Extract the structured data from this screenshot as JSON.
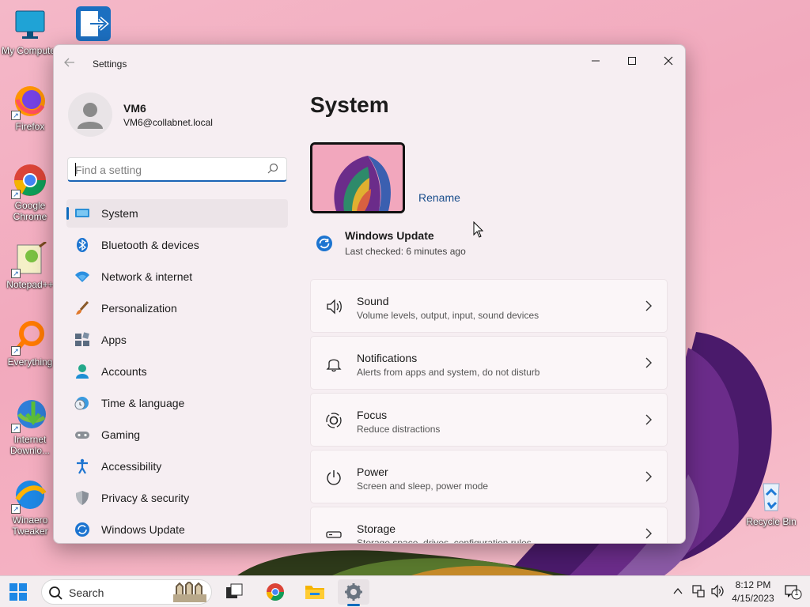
{
  "desktop": {
    "icons": [
      {
        "label": "My Computer",
        "icon": "monitor-icon"
      },
      {
        "label": "",
        "icon": "shortcut-arrow-app-icon"
      },
      {
        "label": "Firefox",
        "icon": "firefox-icon"
      },
      {
        "label": "Google Chrome",
        "icon": "chrome-icon"
      },
      {
        "label": "Notepad++",
        "icon": "notepadpp-icon"
      },
      {
        "label": "Everything",
        "icon": "everything-search-icon"
      },
      {
        "label": "Internet Downlo...",
        "icon": "idm-icon"
      },
      {
        "label": "Winaero Tweaker",
        "icon": "winaero-icon"
      },
      {
        "label": "Recycle Bin",
        "icon": "recycle-bin-icon"
      }
    ]
  },
  "window": {
    "app_title": "Settings",
    "controls": {
      "minimize": "—",
      "maximize": "☐",
      "close": "✕"
    }
  },
  "profile": {
    "name": "VM6",
    "email": "VM6@collabnet.local"
  },
  "search": {
    "placeholder": "Find a setting"
  },
  "nav": {
    "items": [
      {
        "label": "System",
        "icon": "system-display-icon",
        "active": true
      },
      {
        "label": "Bluetooth & devices",
        "icon": "bluetooth-icon"
      },
      {
        "label": "Network & internet",
        "icon": "wifi-icon"
      },
      {
        "label": "Personalization",
        "icon": "paintbrush-icon"
      },
      {
        "label": "Apps",
        "icon": "apps-icon"
      },
      {
        "label": "Accounts",
        "icon": "accounts-icon"
      },
      {
        "label": "Time & language",
        "icon": "globe-clock-icon"
      },
      {
        "label": "Gaming",
        "icon": "gamepad-icon"
      },
      {
        "label": "Accessibility",
        "icon": "accessibility-icon"
      },
      {
        "label": "Privacy & security",
        "icon": "shield-icon"
      },
      {
        "label": "Windows Update",
        "icon": "windows-update-icon"
      }
    ]
  },
  "main": {
    "title": "System",
    "rename": "Rename",
    "windows_update": {
      "title": "Windows Update",
      "subtitle": "Last checked: 6 minutes ago"
    },
    "cards": [
      {
        "title": "Sound",
        "subtitle": "Volume levels, output, input, sound devices",
        "icon": "speaker-icon"
      },
      {
        "title": "Notifications",
        "subtitle": "Alerts from apps and system, do not disturb",
        "icon": "bell-icon"
      },
      {
        "title": "Focus",
        "subtitle": "Reduce distractions",
        "icon": "focus-icon"
      },
      {
        "title": "Power",
        "subtitle": "Screen and sleep, power mode",
        "icon": "power-icon"
      },
      {
        "title": "Storage",
        "subtitle": "Storage space, drives, configuration rules",
        "icon": "storage-icon"
      }
    ]
  },
  "taskbar": {
    "search_label": "Search",
    "time": "8:12 PM",
    "date": "4/15/2023",
    "notification_count": "1"
  },
  "colors": {
    "accent": "#0f6cbd",
    "window_bg": "#f6eef2",
    "wallpaper": "#f2a9bd"
  }
}
